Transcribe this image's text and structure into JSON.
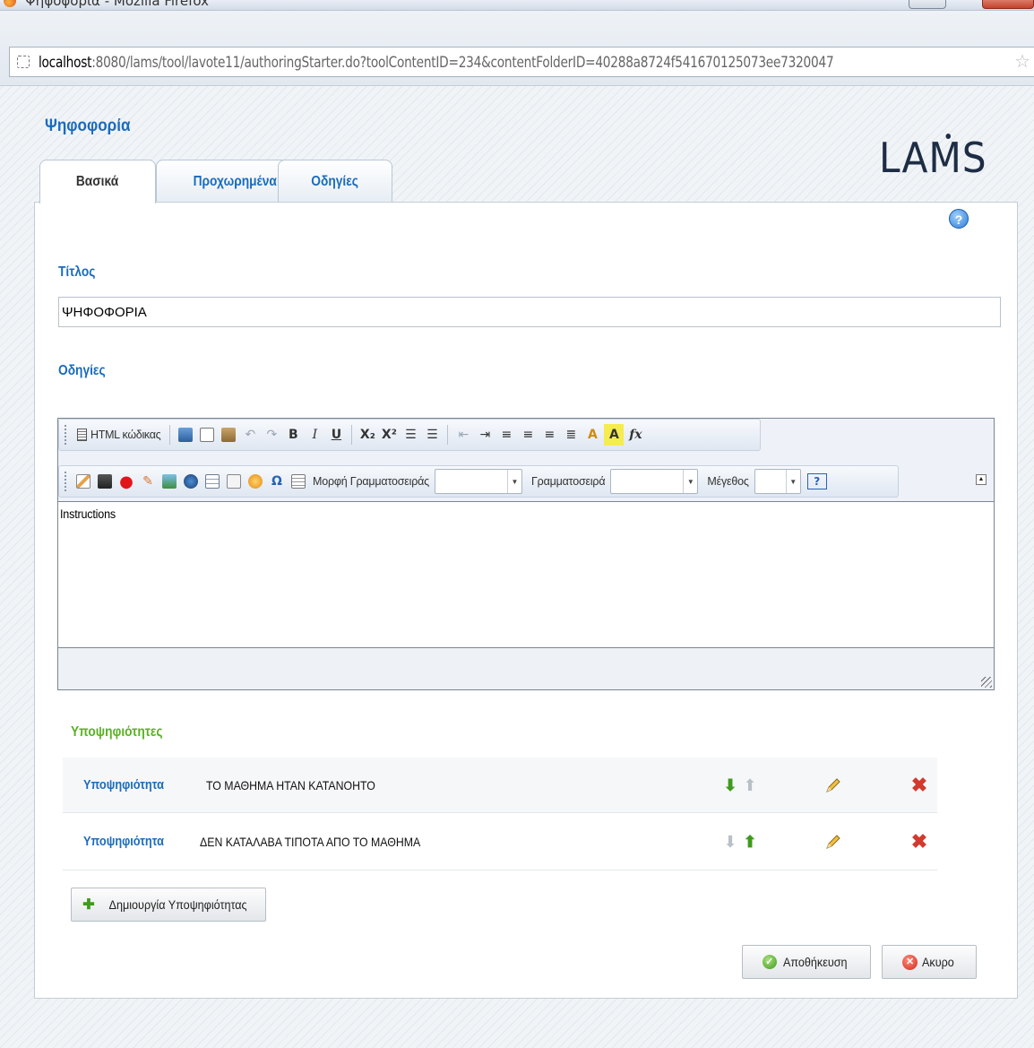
{
  "window": {
    "title": "Ψηφοφορία - Mozilla Firefox"
  },
  "browser": {
    "url_host": "localhost",
    "url_rest": ":8080/lams/tool/lavote11/authoringStarter.do?toolContentID=234&contentFolderID=40288a8724f541670125073ee7320047"
  },
  "page": {
    "title": "Ψηφοφορία",
    "logo": {
      "before": "LA",
      "m": "M",
      "after": "S"
    },
    "help_icon": "?"
  },
  "tabs": [
    {
      "label": "Βασικά",
      "active": true
    },
    {
      "label": "Προχωρημένα",
      "active": false
    },
    {
      "label": "Οδηγίες",
      "active": false
    }
  ],
  "form": {
    "title_label": "Τίτλος",
    "title_value": "ΨΗΦΟΦΟΡΙΑ",
    "instructions_label": "Οδηγίες"
  },
  "editor": {
    "source_label": "HTML κώδικας",
    "font_format_label": "Μορφή Γραμματοσειράς",
    "font_label": "Γραμματοσειρά",
    "size_label": "Μέγεθος",
    "content": "Instructions",
    "buttons": {
      "bold": "B",
      "italic": "I",
      "underline": "U",
      "subscript": "X₂",
      "superscript": "X²",
      "text_color": "A",
      "bg_color": "A",
      "formula": "fx",
      "special_char": "Ω",
      "help": "?"
    }
  },
  "candidates": {
    "heading": "Υποψηφιότητες",
    "items": [
      {
        "label": "Υποψηφιότητα",
        "text": "ΤΟ ΜΑΘΗΜΑ ΗΤΑΝ ΚΑΤΑΝΟΗΤΟ"
      },
      {
        "label": "Υποψηφιότητα",
        "text": "ΔΕΝ ΚΑΤΑΛΑΒΑ ΤΙΠΟΤΑ ΑΠΟ ΤΟ ΜΑΘΗΜΑ"
      }
    ],
    "add_button": "Δημιουργία Υποψηφιότητας"
  },
  "actions": {
    "save": "Αποθήκευση",
    "cancel": "Ακυρο"
  },
  "colors": {
    "link_blue": "#1a6bbd",
    "heading_green": "#5bb025",
    "delete_red": "#d23a2e"
  },
  "icons": [
    "firefox-icon",
    "page-icon",
    "bookmark-star-icon",
    "help-icon",
    "move-down-icon",
    "move-up-icon",
    "edit-pencil-icon",
    "delete-icon",
    "plus-icon",
    "ok-icon",
    "cancel-icon"
  ]
}
